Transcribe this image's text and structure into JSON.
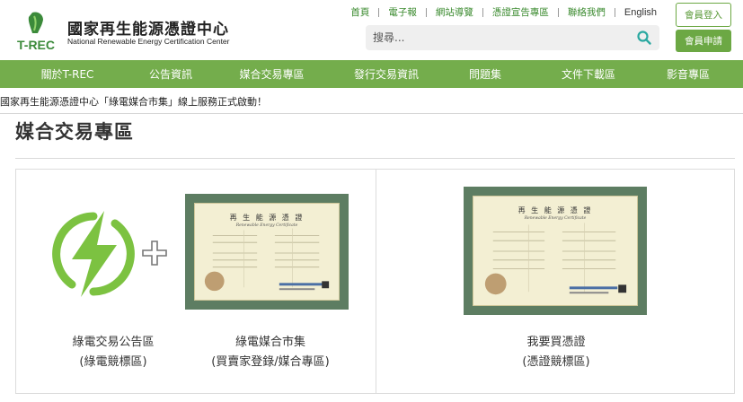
{
  "header": {
    "logo": {
      "mark_text": "T-REC",
      "name_cn": "國家再生能源憑證中心",
      "name_en": "National Renewable Energy Certification Center"
    },
    "top_links": [
      "首頁",
      "電子報",
      "網站導覽",
      "憑證宣告專區",
      "聯絡我們",
      "English"
    ],
    "search": {
      "placeholder": "搜尋..."
    },
    "login_label": "會員登入",
    "apply_label": "會員申請"
  },
  "nav": {
    "items": [
      "關於T-REC",
      "公告資訊",
      "媒合交易專區",
      "發行交易資訊",
      "問題集",
      "文件下載區",
      "影音專區"
    ]
  },
  "marquee": "國家再生能源憑證中心「綠電媒合市集」線上服務正式啟動！",
  "page_title": "媒合交易專區",
  "panels": {
    "left": {
      "item1": {
        "line1": "綠電交易公告區",
        "line2": "(綠電競標區)"
      },
      "item2": {
        "line1": "綠電媒合市集",
        "line2": "(買賣家登錄/媒合專區)"
      }
    },
    "right": {
      "item": {
        "line1": "我要買憑證",
        "line2": "(憑證競標區)"
      }
    }
  },
  "certificate": {
    "title": "再 生 能 源 憑 證",
    "subtitle": "Renewable Energy Certificate"
  },
  "colors": {
    "brand_green": "#74ad4c",
    "link_green": "#3a8a2e",
    "bolt_green": "#7cc241",
    "cert_frame": "#5d7d62"
  }
}
